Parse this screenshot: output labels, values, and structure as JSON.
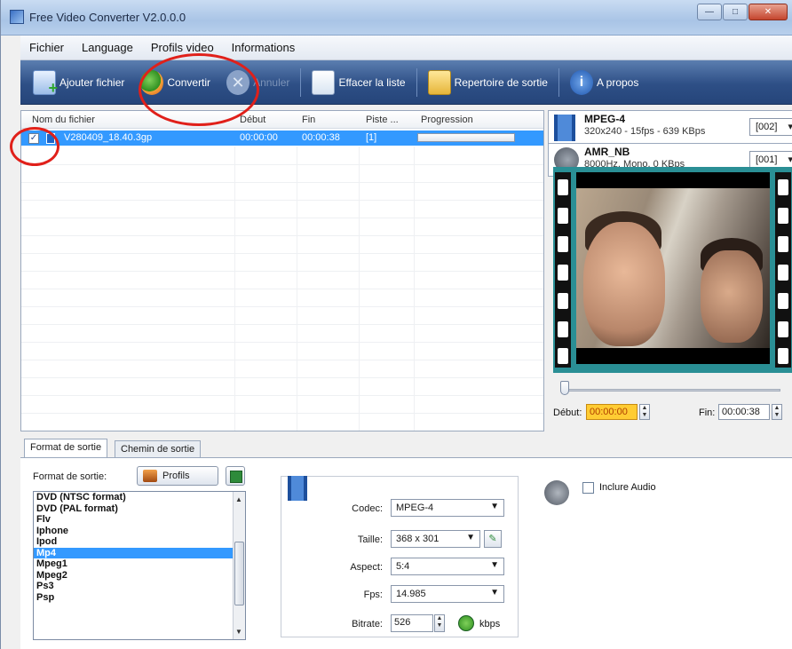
{
  "window": {
    "title": "Free Video Converter V2.0.0.0"
  },
  "menu": [
    "Fichier",
    "Language",
    "Profils video",
    "Informations"
  ],
  "toolbar": {
    "add": "Ajouter fichier",
    "convert": "Convertir",
    "cancel": "Annuler",
    "clear": "Effacer la liste",
    "output_dir": "Repertoire de sortie",
    "about": "A propos"
  },
  "filelist": {
    "columns": [
      "Nom du fichier",
      "Début",
      "Fin",
      "Piste ...",
      "Progression"
    ],
    "rows": [
      {
        "name": "V280409_18.40.3gp",
        "start": "00:00:00",
        "end": "00:00:38",
        "track": "[1]",
        "progress": 0,
        "checked": true
      }
    ]
  },
  "video_stream": {
    "codec": "MPEG-4",
    "details": "320x240 - 15fps - 639 KBps",
    "id": "[002]"
  },
  "audio_stream": {
    "codec": "AMR_NB",
    "details": "8000Hz, Mono, 0 KBps",
    "id": "[001]"
  },
  "trim": {
    "start_label": "Début:",
    "start_value": "00:00:00",
    "end_label": "Fin:",
    "end_value": "00:00:38",
    "slider_position": 0
  },
  "tabs": [
    "Format de sortie",
    "Chemin de sortie"
  ],
  "format": {
    "label": "Format de sortie:",
    "profiles_btn": "Profils",
    "items": [
      "DVD (NTSC format)",
      "DVD (PAL format)",
      "Flv",
      "Iphone",
      "Ipod",
      "Mp4",
      "Mpeg1",
      "Mpeg2",
      "Ps3",
      "Psp"
    ],
    "selected": "Mp4"
  },
  "settings": {
    "codec_label": "Codec:",
    "codec": "MPEG-4",
    "size_label": "Taille:",
    "size": "368 x 301",
    "aspect_label": "Aspect:",
    "aspect": "5:4",
    "fps_label": "Fps:",
    "fps": "14.985",
    "bitrate_label": "Bitrate:",
    "bitrate": "526",
    "bitrate_unit": "kbps"
  },
  "audio": {
    "include_label": "Inclure Audio",
    "checked": false
  },
  "colors": {
    "toolbar": "#2e4f86",
    "selection": "#3399ff",
    "annotation": "#e0201a",
    "highlight": "#ffcc33"
  }
}
